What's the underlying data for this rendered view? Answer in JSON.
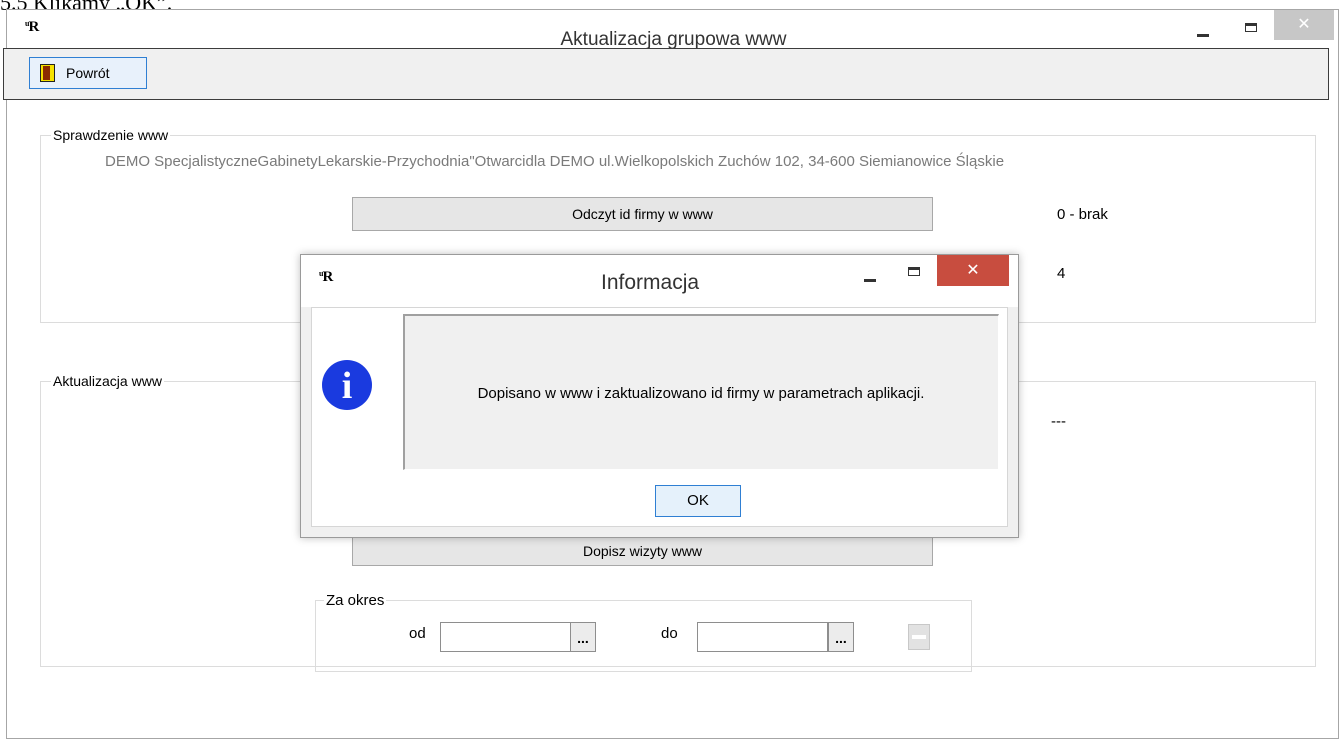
{
  "caption": "5.5 Klikamy „OK”.",
  "main_window": {
    "title": "Aktualizacja grupowa www",
    "app_icon_text": "R",
    "close_glyph": "✕"
  },
  "toolbar": {
    "back_label": "Powrót"
  },
  "check_section": {
    "title": "Sprawdzenie www",
    "company_info": "DEMO SpecjalistyczneGabinetyLekarskie-Przychodnia\"Otwarcidla DEMO ul.Wielkopolskich Zuchów 102, 34-600 Siemianowice Śląskie",
    "read_id_button": "Odczyt id firmy w www",
    "read_id_result": "0 - brak",
    "count_value": "4"
  },
  "update_section": {
    "title": "Aktualizacja www",
    "result": "---",
    "add_visits_button": "Dopisz wizyty www"
  },
  "period": {
    "title": "Za okres",
    "from_label": "od",
    "to_label": "do",
    "from_value": "",
    "to_value": "",
    "picker_label": "..."
  },
  "dialog": {
    "title": "Informacja",
    "app_icon_text": "R",
    "close_glyph": "✕",
    "icon_glyph": "i",
    "message": "Dopisano w www i zaktualizowano id firmy w parametrach aplikacji.",
    "ok_label": "OK"
  },
  "colors": {
    "dialog_close": "#c84d3f",
    "info_icon": "#1a3adf",
    "focus_border": "#2f7fd3"
  }
}
